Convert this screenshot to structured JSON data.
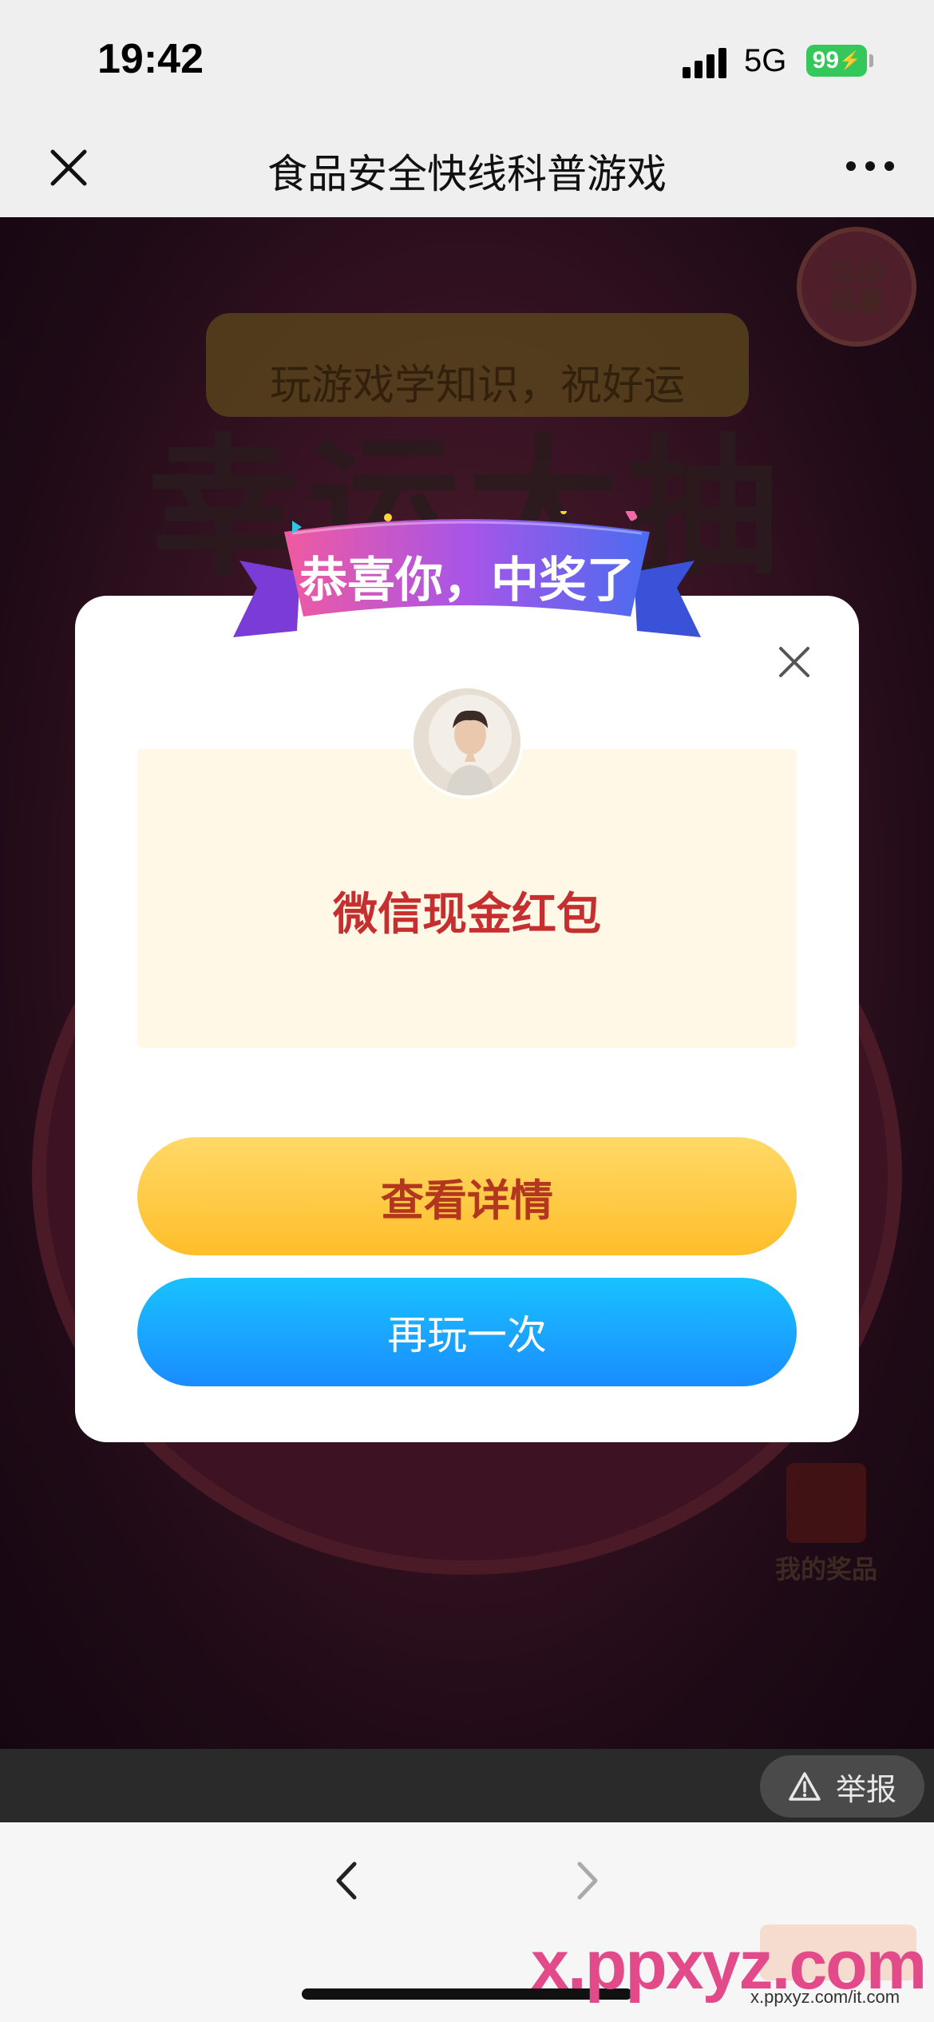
{
  "status": {
    "time": "19:42",
    "network": "5G",
    "battery": "99"
  },
  "nav": {
    "title": "食品安全快线科普游戏"
  },
  "background": {
    "tagline": "玩游戏学知识，祝好运",
    "headline": "幸运大抽奖",
    "badge": "活动\n锦囊",
    "my_prizes": "我的奖品"
  },
  "modal": {
    "ribbon": "恭喜你，中奖了",
    "prize_name": "微信现金红包",
    "detail_button": "查看详情",
    "again_button": "再玩一次"
  },
  "report": {
    "label": "举报"
  },
  "watermark": {
    "text": "x.ppxyz.com",
    "sub": "x.ppxyz.com/it.com"
  },
  "colors": {
    "accent_red": "#c62f2f",
    "detail_yellow": "#ffbe2a",
    "again_blue": "#1a8cff",
    "battery_green": "#34c759"
  },
  "icons": {
    "close": "close-icon",
    "more": "more-icon",
    "back": "chevron-left-icon",
    "forward": "chevron-right-icon",
    "report": "warning-icon"
  }
}
